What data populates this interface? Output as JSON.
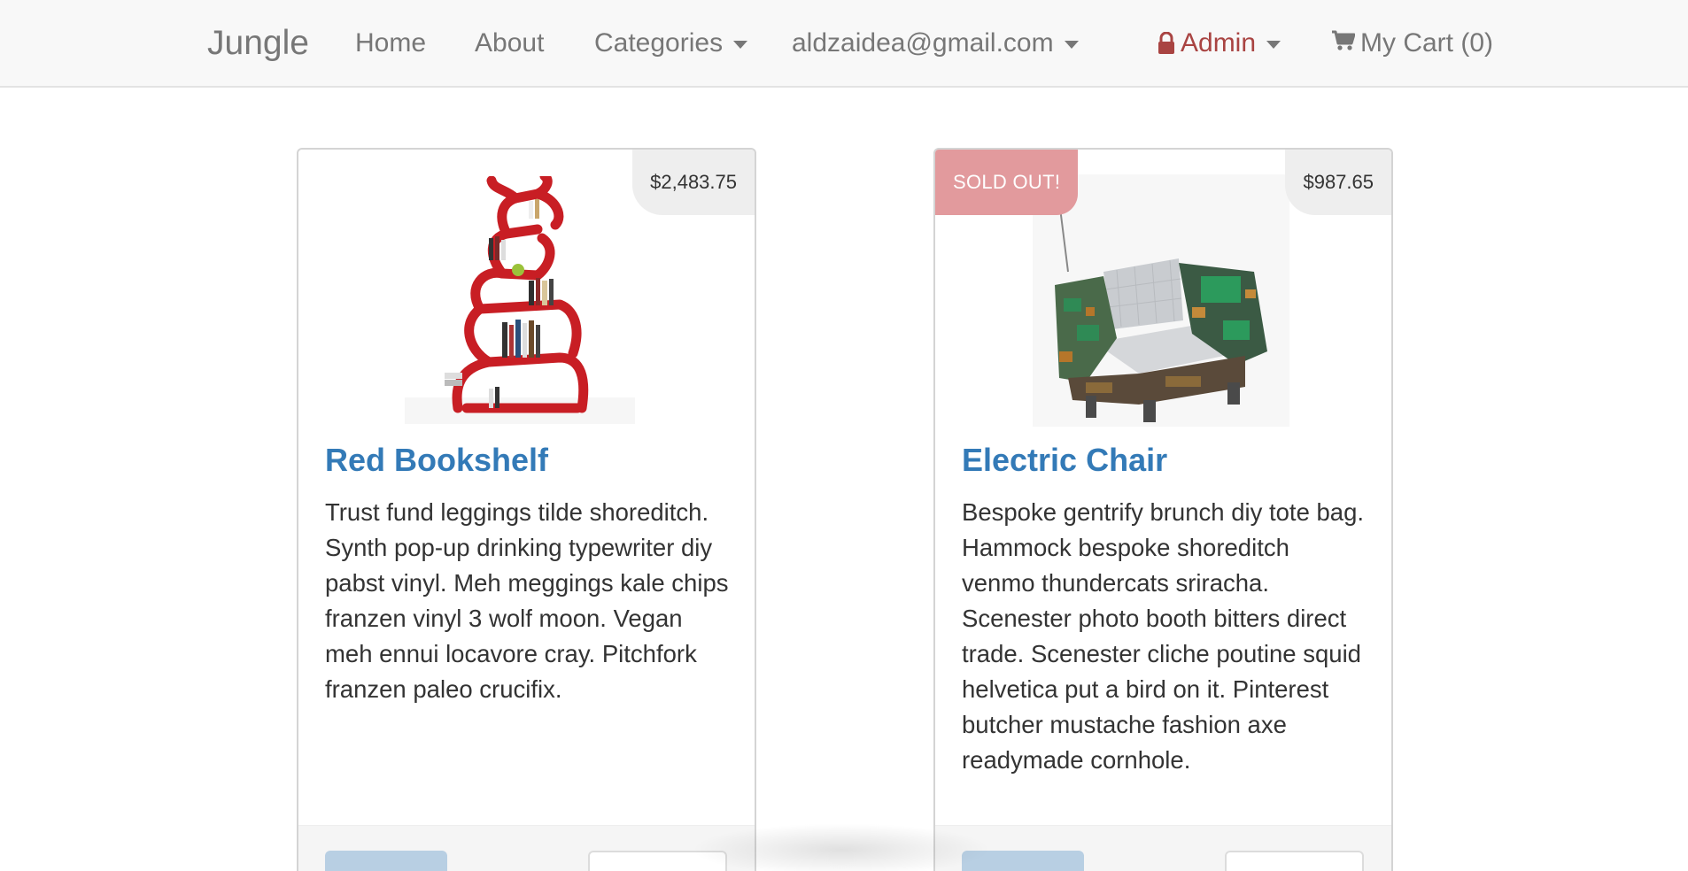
{
  "navbar": {
    "brand": "Jungle",
    "links": {
      "home": "Home",
      "about": "About",
      "categories": "Categories",
      "user_email": "aldzaidea@gmail.com",
      "admin": "Admin",
      "cart": "My Cart (0)"
    },
    "icons": {
      "admin": "lock-icon",
      "cart": "shopping-cart-icon",
      "dropdowns": "caret-down-icon"
    }
  },
  "colors": {
    "link": "#337ab7",
    "admin": "#a94442",
    "sold_out_badge": "#e29a9d",
    "price_tag_bg": "#eeeeee"
  },
  "products": [
    {
      "title": "Red Bookshelf",
      "price": "$2,483.75",
      "sold_out": false,
      "description": "Trust fund leggings tilde shoreditch. Synth pop-up drinking typewriter diy pabst vinyl. Meh meggings kale chips franzen vinyl 3 wolf moon. Vegan meh ennui locavore cray. Pitchfork franzen paleo crucifix.",
      "image": "red-bookshelf-image"
    },
    {
      "title": "Electric Chair",
      "price": "$987.65",
      "sold_out": true,
      "sold_out_label": "SOLD OUT!",
      "description": "Bespoke gentrify brunch diy tote bag. Hammock bespoke shoreditch venmo thundercats sriracha. Scenester photo booth bitters direct trade. Scenester cliche poutine squid helvetica put a bird on it. Pinterest butcher mustache fashion axe readymade cornhole.",
      "image": "electric-chair-image"
    }
  ]
}
